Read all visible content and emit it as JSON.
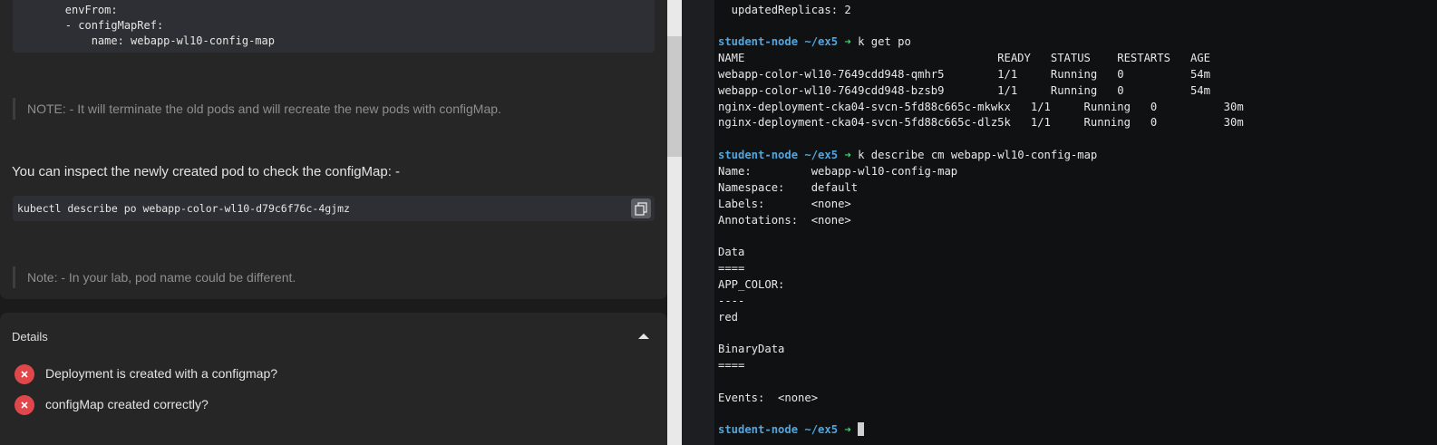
{
  "lesson": {
    "yaml_lines": [
      "        envFrom:",
      "        - configMapRef:",
      "            name: webapp-wl10-config-map"
    ],
    "note1": "NOTE: - It will terminate the old pods and will recreate the new pods with configMap.",
    "inspect_text": "You can inspect the newly created pod to check the configMap: -",
    "command": "kubectl describe po webapp-color-wl10-d79c6f76c-4gjmz",
    "note2": "Note: - In your lab, pod name could be different."
  },
  "details": {
    "title": "Details",
    "checks": [
      {
        "label": "Deployment is created with a configmap?",
        "status": "failed"
      },
      {
        "label": "configMap created correctly?",
        "status": "failed"
      }
    ]
  },
  "handle_glyph": "\"",
  "terminal": {
    "line_updated": "  updatedReplicas: 2",
    "prompt": "student-node ~/ex5",
    "arrow": "➜",
    "cmd1": " k get po",
    "po_header": "NAME                                      READY   STATUS    RESTARTS   AGE",
    "po_rows": [
      "webapp-color-wl10-7649cdd948-qmhr5        1/1     Running   0          54m",
      "webapp-color-wl10-7649cdd948-bzsb9        1/1     Running   0          54m",
      "nginx-deployment-cka04-svcn-5fd88c665c-mkwkx   1/1     Running   0          30m",
      "nginx-deployment-cka04-svcn-5fd88c665c-dlz5k   1/1     Running   0          30m"
    ],
    "cmd2": " k describe cm webapp-wl10-config-map",
    "describe_lines": [
      "Name:         webapp-wl10-config-map",
      "Namespace:    default",
      "Labels:       <none>",
      "Annotations:  <none>",
      "",
      "Data",
      "====",
      "APP_COLOR:",
      "----",
      "red",
      "",
      "BinaryData",
      "====",
      "",
      "Events:  <none>"
    ]
  },
  "colors": {
    "prompt": "#53a5dc",
    "arrow": "#3fd36d",
    "fail": "#e0474b"
  },
  "icons": {
    "copy": "copy-icon",
    "collapse": "chevron-up-icon",
    "fail": "close-icon"
  }
}
